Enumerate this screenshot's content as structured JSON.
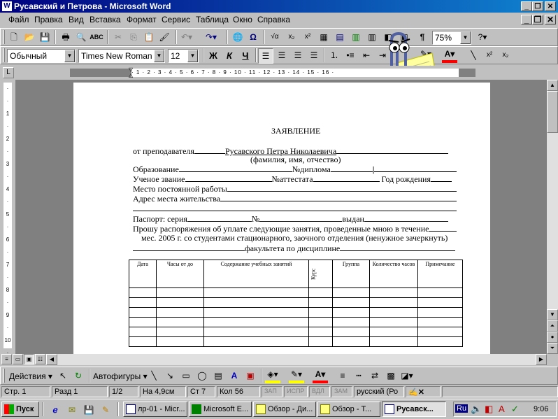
{
  "window": {
    "title": "Русавский и Петрова - Microsoft Word"
  },
  "menu": [
    "Файл",
    "Правка",
    "Вид",
    "Вставка",
    "Формат",
    "Сервис",
    "Таблица",
    "Окно",
    "Справка"
  ],
  "toolbar": {
    "zoom": "75%"
  },
  "format_bar": {
    "style": "Обычный",
    "font": "Times New Roman",
    "size": "12",
    "bold": "Ж",
    "italic": "К",
    "underline": "Ч"
  },
  "document": {
    "heading": "ЗАЯВЛЕНИЕ",
    "from_label": "от преподавателя",
    "teacher_name": "Русавского  Петра  Николаевича",
    "fio_caption": "(фамилия, имя, отчество)",
    "education_label": "Образование",
    "diploma_label": "№диплома",
    "degree_label": "Ученое звание",
    "certificate_label": "№аттестата",
    "birth_label": "Год рождения",
    "workplace_label": "Место постоянной работы",
    "address_label": "Адрес места жительства",
    "passport_label": "Паспорт:  серия",
    "passport_no": "№",
    "issued_label": "выдан",
    "request_text": "Прошу распоряжения об уплате следующие занятия, проведенные мною в течение",
    "request_text2": "мес. 2005 г. со студентами стационарного, заочного отделения (ненужное зачеркнуть)",
    "faculty_text": "факультета по дисциплине",
    "table_headers": [
      "Дата",
      "Часы от до",
      "Содержание учебных занятий",
      "Курс",
      "Группа",
      "Количество часов",
      "Примечание"
    ]
  },
  "drawing": {
    "actions": "Действия",
    "autoshapes": "Автофигуры"
  },
  "status": {
    "page": "Стр.  1",
    "section": "Разд  1",
    "pages": "1/2",
    "at": "На  4,9см",
    "line": "Ст  7",
    "col": "Кол  56",
    "rec": "ЗАП",
    "trk": "ИСПР",
    "ext": "ВДЛ",
    "ovr": "ЗАМ",
    "lang": "русский (Ро"
  },
  "taskbar": {
    "start": "Пуск",
    "tasks": [
      "лр-01 - Micr...",
      "Microsoft E...",
      "Обзор - Ди...",
      "Обзор - Т...",
      "Русавск..."
    ],
    "lang": "Ru",
    "clock": "9:06"
  },
  "colors": {
    "title_start": "#000080",
    "title_end": "#1084d0",
    "highlight": "#ffff00",
    "font_color": "#ff0000"
  }
}
